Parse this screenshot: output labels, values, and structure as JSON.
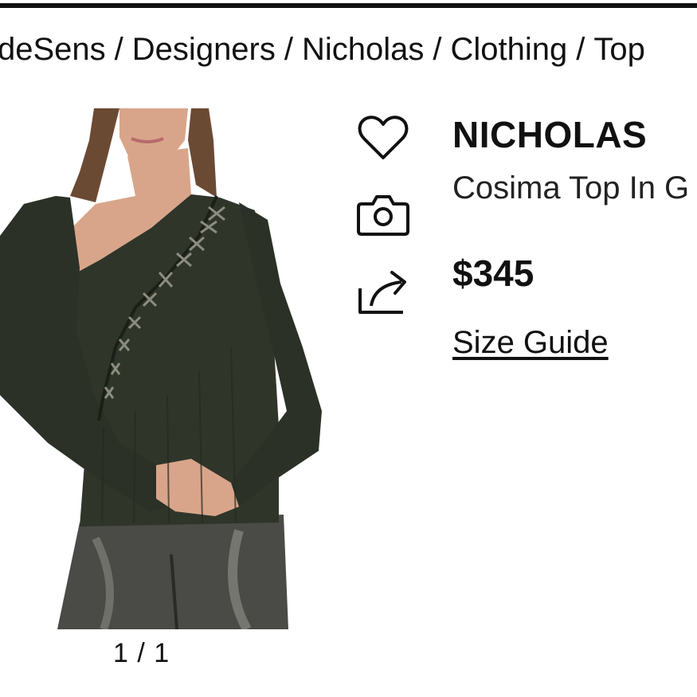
{
  "breadcrumb": {
    "items": [
      "deSens",
      "Designers",
      "Nicholas",
      "Clothing",
      "Top"
    ],
    "separator": "/"
  },
  "gallery": {
    "counter": "1 / 1"
  },
  "actions": {
    "icons": [
      "heart-icon",
      "camera-icon",
      "share-icon"
    ]
  },
  "product": {
    "brand": "NICHOLAS",
    "name": "Cosima Top In G",
    "price": "$345",
    "size_guide_label": "Size Guide"
  },
  "colors": {
    "text": "#111111",
    "top_rule": "#111111",
    "garment": "#2f3529",
    "trousers": "#4a4a46"
  }
}
